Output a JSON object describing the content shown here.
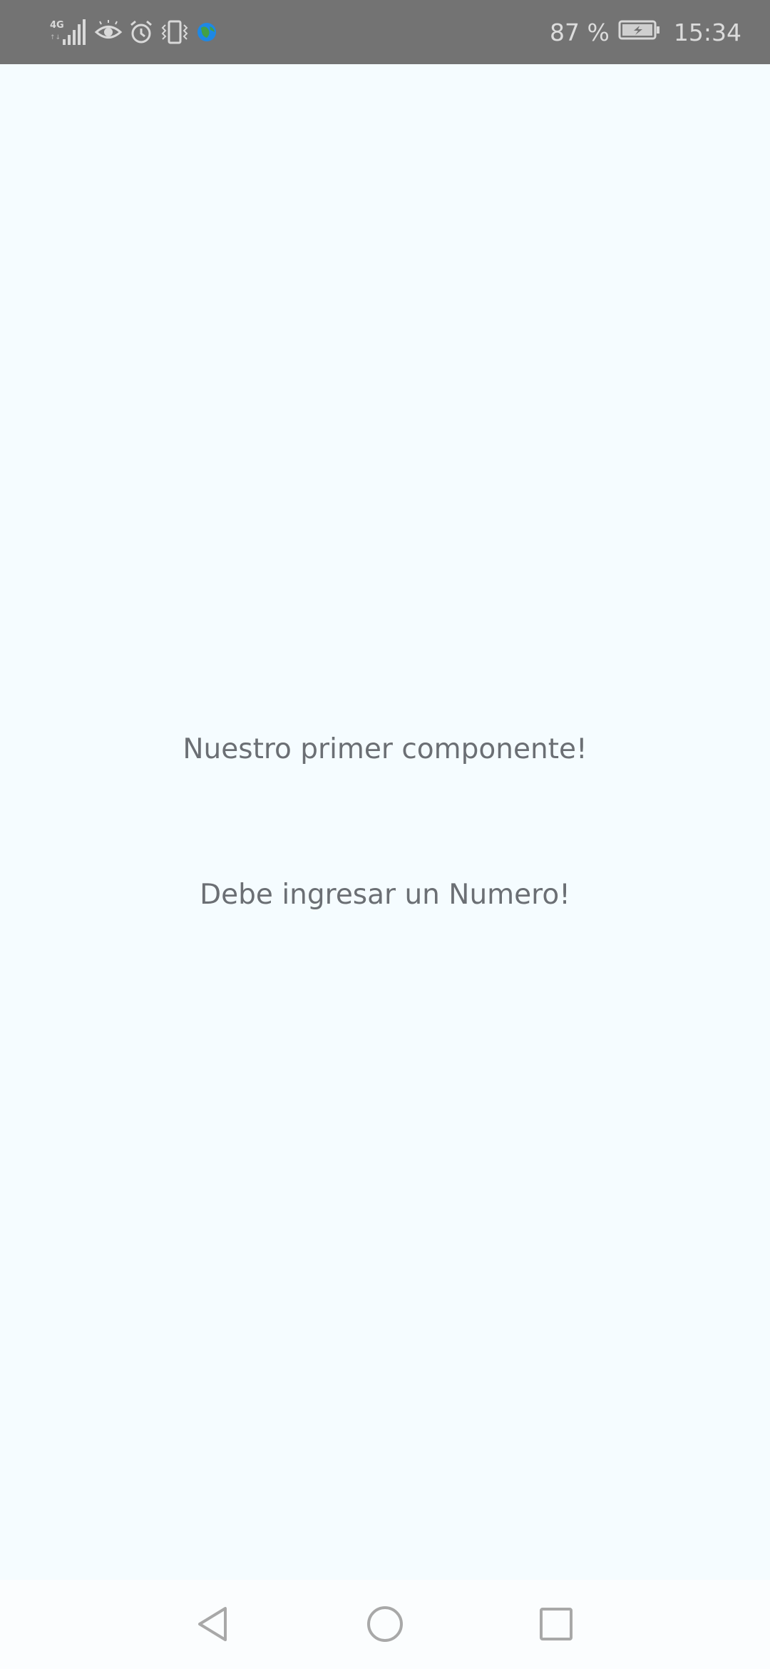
{
  "status_bar": {
    "network_label": "4G",
    "battery": "87 %",
    "time": "15:34",
    "icons": [
      "signal-icon",
      "eye-icon",
      "alarm-icon",
      "vibrate-icon",
      "app-globe-icon",
      "battery-charging-icon"
    ],
    "background": "#737373",
    "icon_color": "#d9d9d9",
    "app_icon_colors": [
      "#1e88e5",
      "#43a047"
    ]
  },
  "main": {
    "headline": "Nuestro primer componente!",
    "message": "Debe ingresar un Numero!",
    "background": "#f5fcff",
    "text_color": "#6b6f74"
  },
  "nav_bar": {
    "buttons": [
      "back-icon",
      "home-icon",
      "recent-apps-icon"
    ],
    "icon_color": "#a8a8a8"
  }
}
